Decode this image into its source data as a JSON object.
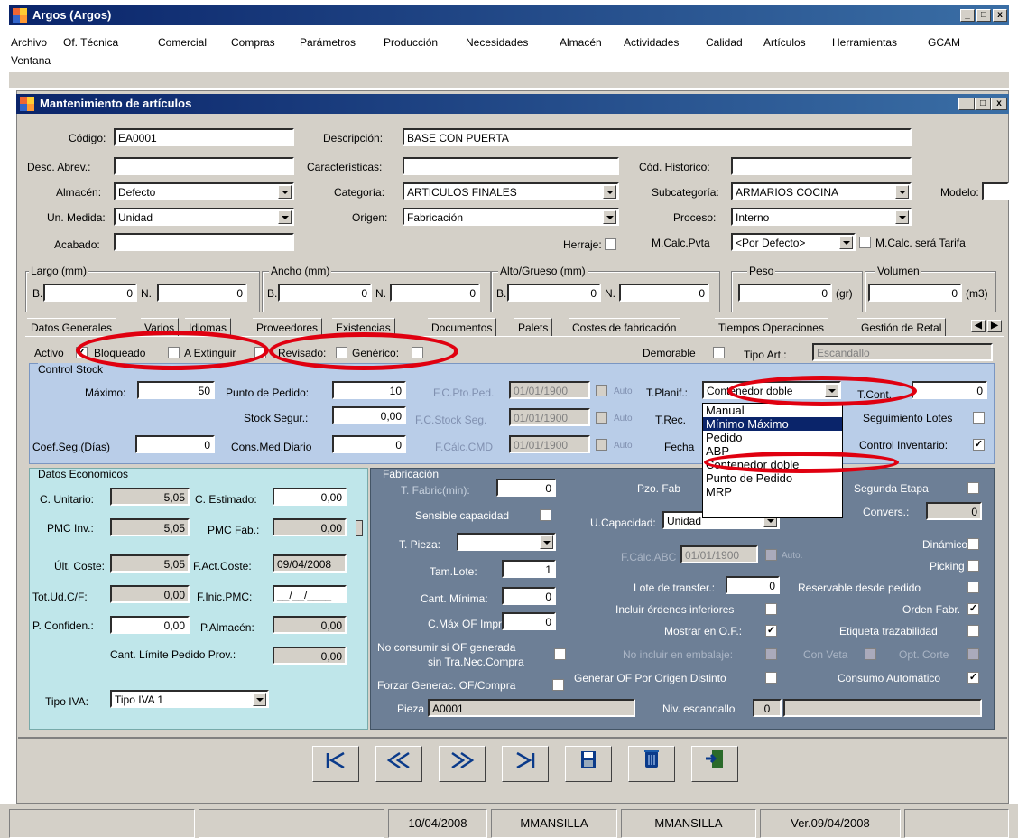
{
  "app": {
    "title": "Argos (Argos)",
    "min": "_",
    "max": "□",
    "close": "x"
  },
  "menu": [
    "Archivo",
    "Of. Técnica",
    "Comercial",
    "Compras",
    "Parámetros",
    "Producción",
    "Necesidades",
    "Almacén",
    "Actividades",
    "Calidad",
    "Artículos",
    "Herramientas",
    "GCAM",
    "Ventana"
  ],
  "child": {
    "title": "Mantenimiento de artículos"
  },
  "form": {
    "codigo_label": "Código:",
    "codigo": "EA0001",
    "descripcion_label": "Descripción:",
    "descripcion": "BASE CON PUERTA",
    "desc_abrev_label": "Desc. Abrev.:",
    "desc_abrev": "",
    "caracteristicas_label": "Características:",
    "caracteristicas": "",
    "cod_historico_label": "Cód. Historico:",
    "cod_historico": "",
    "almacen_label": "Almacén:",
    "almacen": "Defecto",
    "categoria_label": "Categoría:",
    "categoria": "ARTICULOS FINALES",
    "subcategoria_label": "Subcategoría:",
    "subcategoria": "ARMARIOS COCINA",
    "modelo_label": "Modelo:",
    "modelo": "",
    "un_medida_label": "Un. Medida:",
    "un_medida": "Unidad",
    "origen_label": "Origen:",
    "origen": "Fabricación",
    "proceso_label": "Proceso:",
    "proceso": "Interno",
    "acabado_label": "Acabado:",
    "acabado": "",
    "herraje_label": "Herraje:",
    "mcalc_label": "M.Calc.Pvta",
    "mcalc": "<Por Defecto>",
    "mcalc_tarifa_label": "M.Calc. será Tarifa"
  },
  "dims": {
    "largo": "Largo (mm)",
    "ancho": "Ancho (mm)",
    "alto": "Alto/Grueso (mm)",
    "peso": "Peso",
    "volumen": "Volumen",
    "b": "B.",
    "n": "N.",
    "zero": "0",
    "gr": "(gr)",
    "m3": "(m3)"
  },
  "tabs": [
    "Datos Generales",
    "Varios",
    "Idiomas",
    "Proveedores",
    "Existencias",
    "Documentos",
    "Palets",
    "Costes de fabricación",
    "Tiempos Operaciones",
    "Gestión de Retal"
  ],
  "flags": {
    "activo": "Activo",
    "bloqueado": "Bloqueado",
    "a_extinguir": "A Extinguir",
    "revisado": "Revisado:",
    "generico": "Genérico:",
    "demorable": "Demorable",
    "tipo_art": "Tipo Art.:",
    "tipo_art_val": "Escandallo"
  },
  "stock": {
    "group": "Control Stock",
    "maximo_label": "Máximo:",
    "maximo": "50",
    "punto_pedido_label": "Punto de Pedido:",
    "punto_pedido": "10",
    "stock_segur_label": "Stock Segur.:",
    "stock_segur": "0,00",
    "coef_seg_label": "Coef.Seg.(Días)",
    "coef_seg": "0",
    "cons_med_label": "Cons.Med.Diario",
    "cons_med": "0",
    "fc_pto_label": "F.C.Pto.Ped.",
    "fc_stock_label": "F.C.Stock Seg.",
    "fc_calc_label": "F.Cálc.CMD",
    "fecha": "01/01/1900",
    "auto": "Auto",
    "tplanif_label": "T.Planif.:",
    "tplanif": "Contenedor doble",
    "trec_label": "T.Rec.",
    "fecha_label": "Fecha",
    "tcont_label": "T.Cont.",
    "tcont": "0",
    "seg_lotes": "Seguimiento Lotes",
    "control_inv": "Control Inventario:"
  },
  "dropdown": [
    "Manual",
    "Mínimo Máximo",
    "Pedido",
    "ABP",
    "Contenedor doble",
    "Punto de Pedido",
    "MRP"
  ],
  "econ": {
    "group": "Datos Economicos",
    "c_unitario_label": "C. Unitario:",
    "c_unitario": "5,05",
    "c_estimado_label": "C. Estimado:",
    "c_estimado": "0,00",
    "pmc_inv_label": "PMC Inv.:",
    "pmc_inv": "5,05",
    "pmc_fab_label": "PMC Fab.:",
    "pmc_fab": "0,00",
    "ult_coste_label": "Últ. Coste:",
    "ult_coste": "5,05",
    "fact_coste_label": "F.Act.Coste:",
    "fact_coste": "09/04/2008",
    "tot_ud_label": "Tot.Ud.C/F:",
    "tot_ud": "0,00",
    "finic_pmc_label": "F.Inic.PMC:",
    "finic_pmc": "__/__/____",
    "p_confiden_label": "P. Confiden.:",
    "p_confiden": "0,00",
    "p_almacen_label": "P.Almacén:",
    "p_almacen": "0,00",
    "cant_limite_label": "Cant. Límite Pedido Prov.:",
    "cant_limite": "0,00",
    "tipo_iva_label": "Tipo IVA:",
    "tipo_iva": "Tipo IVA 1"
  },
  "fab": {
    "group": "Fabricación",
    "t_fabric_label": "T. Fabric(min):",
    "t_fabric": "0",
    "pzo_fab_label": "Pzo. Fab",
    "sensible_label": "Sensible capacidad",
    "ucapacidad_label": "U.Capacidad:",
    "ucapacidad": "Unidad",
    "t_pieza_label": "T. Pieza:",
    "fcalc_abc_label": "F.Cálc.ABC",
    "fcalc_abc": "01/01/1900",
    "auto": "Auto.",
    "tam_lote_label": "Tam.Lote:",
    "tam_lote": "1",
    "lote_transf_label": "Lote de transfer.:",
    "lote_transf": "0",
    "cant_minima_label": "Cant. Mínima:",
    "cant_minima": "0",
    "incluir_ordenes_label": "Incluir órdenes inferiores",
    "cmax_label": "C.Máx OF Impr.:",
    "cmax": "0",
    "mostrar_of_label": "Mostrar en O.F.:",
    "no_consumir_1": "No consumir si OF generada",
    "no_consumir_2": "sin Tra.Nec.Compra",
    "no_incluir_label": "No incluir en embalaje:",
    "con_veta_label": "Con Veta",
    "opt_corte_label": "Opt. Corte",
    "forzar_label": "Forzar Generac. OF/Compra",
    "generar_of_label": "Generar OF Por Origen Distinto",
    "consumo_label": "Consumo Automático",
    "segunda_etapa_label": "Segunda Etapa",
    "convers_label": "Convers.:",
    "convers": "0",
    "dinamico_label": "Dinámico",
    "picking_label": "Picking",
    "reservable_label": "Reservable desde pedido",
    "orden_fabr_label": "Orden Fabr.",
    "etiqueta_label": "Etiqueta trazabilidad",
    "pieza_label": "Pieza",
    "pieza": "A0001",
    "niv_label": "Niv. escandallo",
    "niv": "0"
  },
  "nav": {
    "first": "K",
    "prev": "«",
    "next": "»",
    "last": "»|",
    "save": "save-icon",
    "delete": "trash-icon",
    "exit": "exit-icon"
  },
  "status": [
    "",
    "",
    "10/04/2008",
    "MMANSILLA",
    "MMANSILLA",
    "Ver.09/04/2008",
    ""
  ],
  "colors": {
    "title": "#0a246a",
    "stock_panel": "#b9cde8",
    "econ_panel": "#bfe6ea",
    "fab_panel": "#6d7f96",
    "highlight": "#e00010"
  }
}
